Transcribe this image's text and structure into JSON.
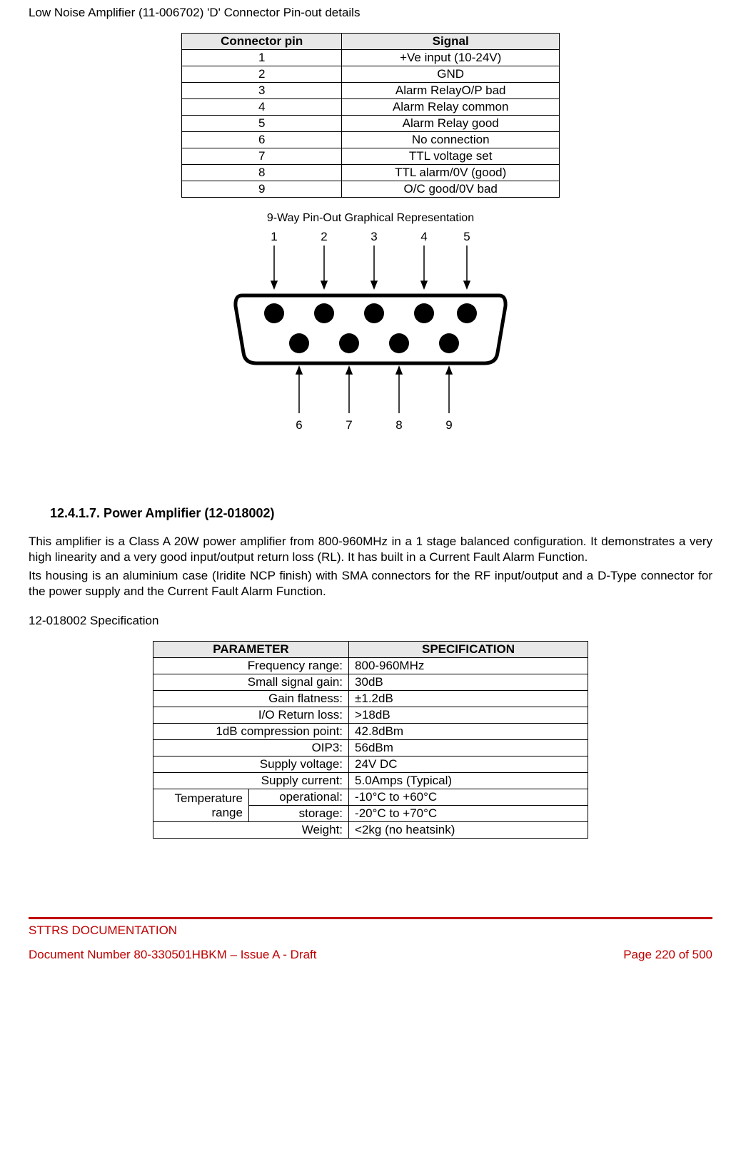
{
  "title": "Low Noise Amplifier (11-006702) 'D' Connector Pin-out details",
  "pinout_table": {
    "headers": {
      "c1": "Connector pin",
      "c2": "Signal"
    },
    "rows": [
      {
        "pin": "1",
        "signal": "+Ve input (10-24V)"
      },
      {
        "pin": "2",
        "signal": "GND"
      },
      {
        "pin": "3",
        "signal": "Alarm RelayO/P bad"
      },
      {
        "pin": "4",
        "signal": "Alarm Relay common"
      },
      {
        "pin": "5",
        "signal": "Alarm Relay good"
      },
      {
        "pin": "6",
        "signal": "No connection"
      },
      {
        "pin": "7",
        "signal": "TTL voltage set"
      },
      {
        "pin": "8",
        "signal": "TTL alarm/0V (good)"
      },
      {
        "pin": "9",
        "signal": "O/C good/0V bad"
      }
    ]
  },
  "connector_caption": "9-Way Pin-Out Graphical Representation",
  "connector_labels": {
    "top": [
      "1",
      "2",
      "3",
      "4",
      "5"
    ],
    "bottom": [
      "6",
      "7",
      "8",
      "9"
    ]
  },
  "section_heading": "12.4.1.7.   Power Amplifier (12-018002)",
  "para1": "This amplifier is a Class A 20W power amplifier from 800-960MHz in a 1 stage balanced configuration. It demonstrates a very high linearity and a very good input/output return loss (RL). It has built in a Current Fault Alarm Function.",
  "para2": "Its housing is an aluminium case (Iridite NCP finish) with SMA connectors for the RF input/output and a D-Type connector for the power supply and the Current Fault Alarm Function.",
  "spec_title": "12-018002 Specification",
  "spec_table": {
    "headers": {
      "c1": "PARAMETER",
      "c2": "SPECIFICATION"
    },
    "rows": [
      {
        "param": "Frequency range:",
        "val": "800-960MHz"
      },
      {
        "param": "Small signal gain:",
        "val": "30dB"
      },
      {
        "param": "Gain flatness:",
        "val": "±1.2dB"
      },
      {
        "param": "I/O Return loss:",
        "val": ">18dB"
      },
      {
        "param": "1dB compression point:",
        "val": "42.8dBm"
      },
      {
        "param": "OIP3:",
        "val": "56dBm"
      },
      {
        "param": "Supply voltage:",
        "val": "24V DC"
      },
      {
        "param": "Supply current:",
        "val": "5.0Amps (Typical)"
      }
    ],
    "temp_group": {
      "group_label": "Temperature range",
      "rows": [
        {
          "sub": "operational:",
          "val": "-10°C to +60°C"
        },
        {
          "sub": "storage:",
          "val": "-20°C to +70°C"
        }
      ]
    },
    "last_row": {
      "param": "Weight:",
      "val": "<2kg (no heatsink)"
    }
  },
  "footer": {
    "line1": "STTRS DOCUMENTATION",
    "left": "Document Number 80-330501HBKM – Issue A - Draft",
    "right": "Page 220 of 500"
  }
}
